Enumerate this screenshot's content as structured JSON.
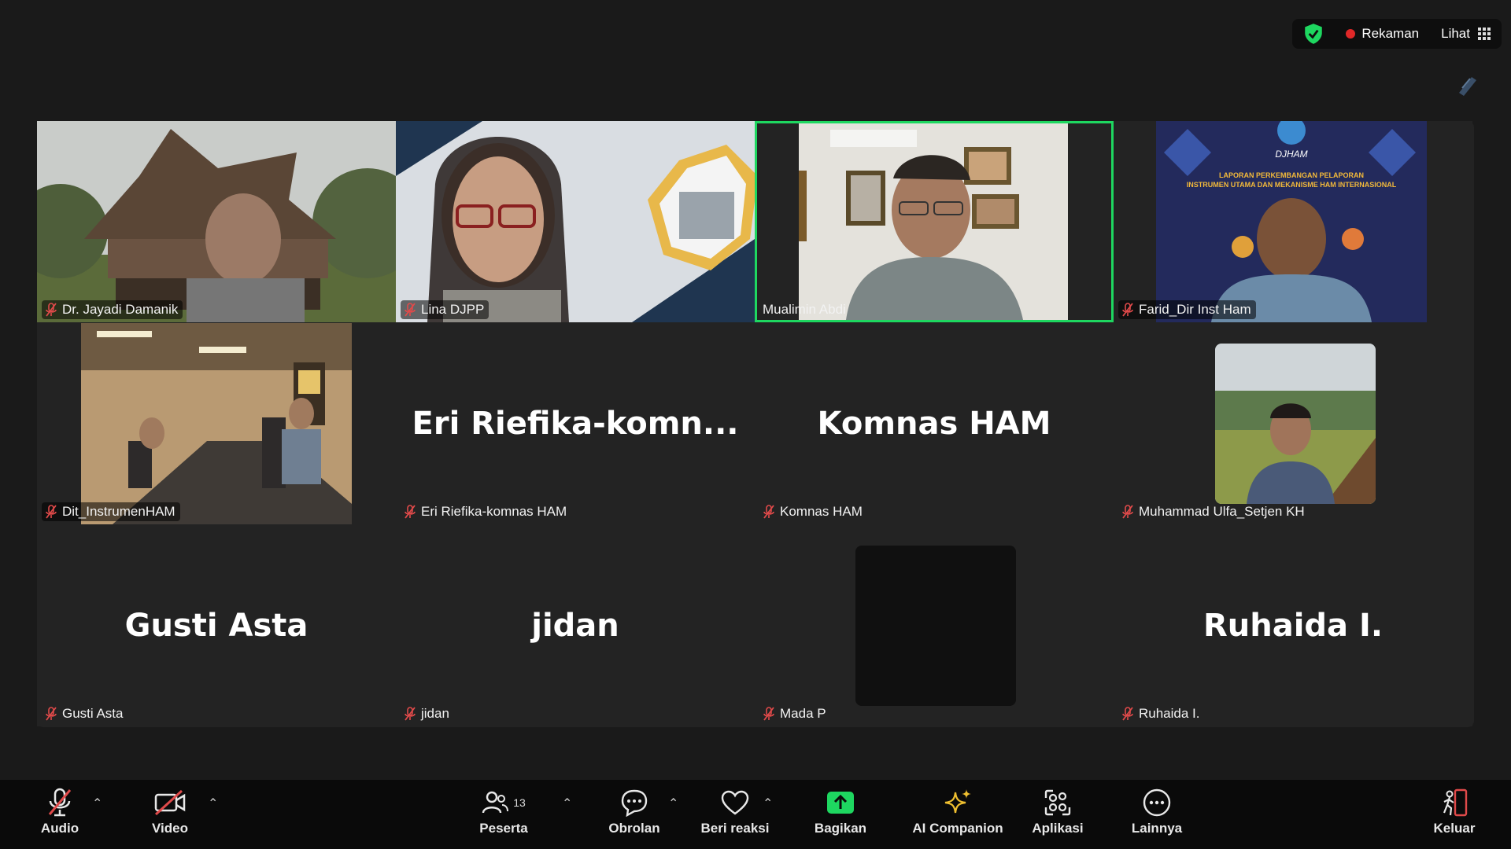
{
  "topbar": {
    "recording": "Rekaman",
    "view": "Lihat"
  },
  "tiles": [
    {
      "name": "Dr. Jayadi Damanik"
    },
    {
      "name": "Lina DJPP"
    },
    {
      "name": "Mualimin Abdi"
    },
    {
      "name": "Farid_Dir Inst Ham"
    },
    {
      "name": "Dit_InstrumenHAM"
    },
    {
      "name": "Eri Riefika-komnas HAM",
      "big": "Eri  Riefika-komn..."
    },
    {
      "name": "Komnas HAM",
      "big": "Komnas HAM"
    },
    {
      "name": "Muhammad Ulfa_Setjen KH"
    },
    {
      "name": "Gusti Asta",
      "big": "Gusti Asta"
    },
    {
      "name": "jidan",
      "big": "jidan"
    },
    {
      "name": "Mada P"
    },
    {
      "name": "Ruhaida I.",
      "big": "Ruhaida I."
    }
  ],
  "video_texts": {
    "djham": "DJHAM",
    "report_title_1": "LAPORAN PERKEMBANGAN PELAPORAN",
    "report_title_2": "INSTRUMEN UTAMA DAN MEKANISME HAM INTERNASIONAL"
  },
  "toolbar": {
    "audio": "Audio",
    "video": "Video",
    "participants": "Peserta",
    "participants_count": "13",
    "chat": "Obrolan",
    "react": "Beri reaksi",
    "share": "Bagikan",
    "ai": "AI Companion",
    "apps": "Aplikasi",
    "more": "Lainnya",
    "leave": "Keluar"
  },
  "colors": {
    "active_speaker": "#1ed760",
    "share": "#1ed760",
    "record_dot": "#e02828",
    "mute": "#e04a4a",
    "leave": "#e04a4a"
  }
}
